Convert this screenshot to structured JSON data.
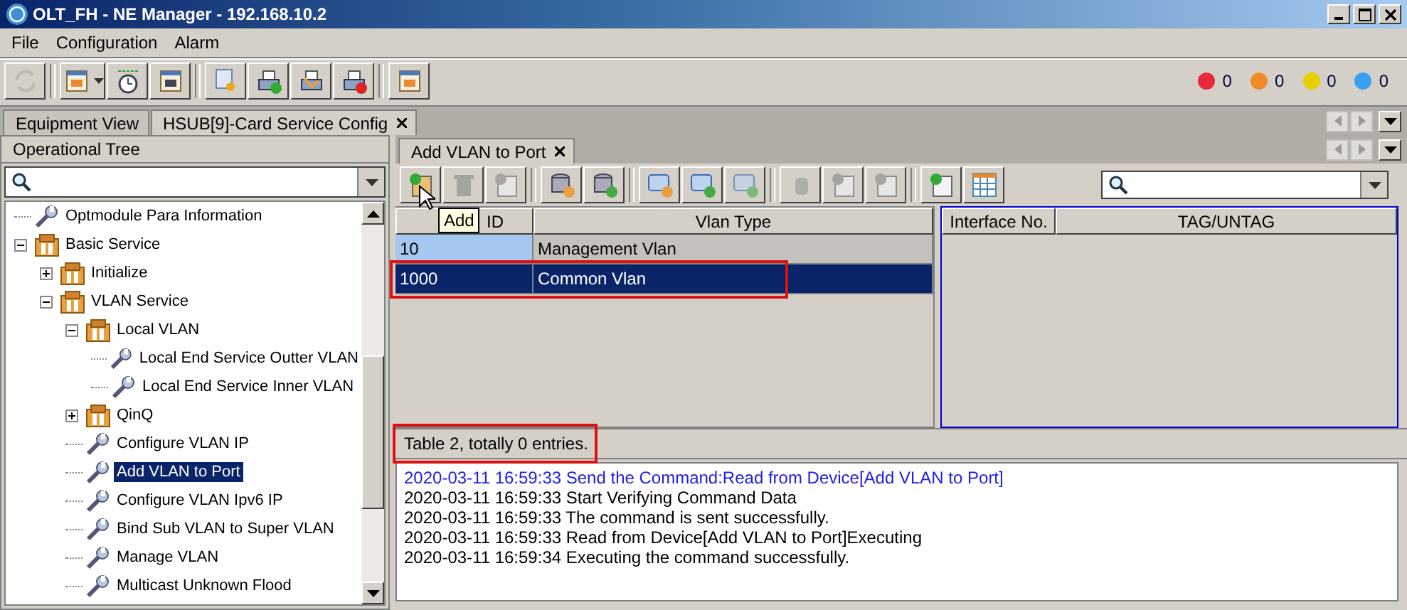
{
  "window": {
    "title": "OLT_FH - NE Manager - 192.168.10.2"
  },
  "menu": [
    "File",
    "Configuration",
    "Alarm"
  ],
  "toolbar": [
    [
      {
        "disabled": true
      }
    ],
    [
      {
        "disabled": false,
        "dropdown": true
      },
      {
        "disabled": false
      },
      {
        "disabled": false
      }
    ],
    [
      {
        "disabled": false
      },
      {
        "disabled": false
      },
      {
        "disabled": false
      },
      {
        "disabled": false
      }
    ],
    [
      {
        "disabled": false
      }
    ]
  ],
  "alarms": [
    {
      "color": "#e8283c",
      "count": "0"
    },
    {
      "color": "#f08a24",
      "count": "0"
    },
    {
      "color": "#e8d000",
      "count": "0"
    },
    {
      "color": "#3aa0f0",
      "count": "0"
    }
  ],
  "tabs": [
    {
      "label": "Equipment View",
      "selected": false,
      "closable": false
    },
    {
      "label": "HSUB[9]-Card Service Config",
      "selected": true,
      "closable": true
    }
  ],
  "tree_panel": {
    "title": "Operational Tree",
    "items": [
      {
        "label": "Optmodule Para Information",
        "kind": "leaf",
        "selected": false
      },
      {
        "label": "Basic Service",
        "kind": "folder",
        "expanded": true,
        "selected": false,
        "children": [
          {
            "label": "Initialize",
            "kind": "folder",
            "expanded": false,
            "selected": false
          },
          {
            "label": "VLAN Service",
            "kind": "folder",
            "expanded": true,
            "selected": false,
            "children": [
              {
                "label": "Local VLAN",
                "kind": "folder",
                "expanded": true,
                "selected": false,
                "children": [
                  {
                    "label": "Local End Service Outter VLAN",
                    "kind": "leaf",
                    "selected": false
                  },
                  {
                    "label": "Local End Service Inner VLAN",
                    "kind": "leaf",
                    "selected": false
                  }
                ]
              },
              {
                "label": "QinQ",
                "kind": "folder",
                "expanded": false,
                "selected": false
              },
              {
                "label": "Configure VLAN IP",
                "kind": "leaf",
                "selected": false
              },
              {
                "label": "Add VLAN to Port",
                "kind": "leaf",
                "selected": true
              },
              {
                "label": "Configure VLAN Ipv6 IP",
                "kind": "leaf",
                "selected": false
              },
              {
                "label": "Bind Sub VLAN to Super VLAN",
                "kind": "leaf",
                "selected": false
              },
              {
                "label": "Manage VLAN",
                "kind": "leaf",
                "selected": false
              },
              {
                "label": "Multicast Unknown Flood",
                "kind": "leaf",
                "selected": false
              }
            ]
          }
        ]
      }
    ]
  },
  "inner_tab": {
    "label": "Add VLAN to Port",
    "selected": true
  },
  "inner_toolbar": [
    [
      {
        "disabled": false
      },
      {
        "disabled": true
      },
      {
        "disabled": true
      }
    ],
    [
      {
        "disabled": false
      },
      {
        "disabled": false
      }
    ],
    [
      {
        "disabled": false
      },
      {
        "disabled": false
      },
      {
        "disabled": true
      }
    ],
    [
      {
        "disabled": true
      },
      {
        "disabled": true
      },
      {
        "disabled": true
      }
    ],
    [
      {
        "disabled": false
      },
      {
        "disabled": false
      }
    ]
  ],
  "tooltip": "Add",
  "main_table": {
    "columns": [
      "ID",
      "Vlan Type"
    ],
    "rows": [
      {
        "cells": [
          "10",
          "Management Vlan"
        ],
        "selected": false,
        "highlighted": false
      },
      {
        "cells": [
          "1000",
          "Common Vlan"
        ],
        "selected": true,
        "highlighted": true
      }
    ]
  },
  "side_table": {
    "columns": [
      "Interface No.",
      "TAG/UNTAG"
    ]
  },
  "status": {
    "text": "Table 2, totally 0 entries.",
    "highlighted": true
  },
  "log": [
    {
      "text": "2020-03-11 16:59:33 Send the Command:Read from Device[Add VLAN to Port]",
      "kind": "info"
    },
    {
      "text": "2020-03-11 16:59:33 Start Verifying Command Data",
      "kind": "normal"
    },
    {
      "text": "2020-03-11 16:59:33 The command is sent successfully.",
      "kind": "normal"
    },
    {
      "text": "2020-03-11 16:59:33 Read from Device[Add VLAN to Port]Executing",
      "kind": "normal"
    },
    {
      "text": "2020-03-11 16:59:34 Executing the command successfully.",
      "kind": "normal"
    }
  ]
}
